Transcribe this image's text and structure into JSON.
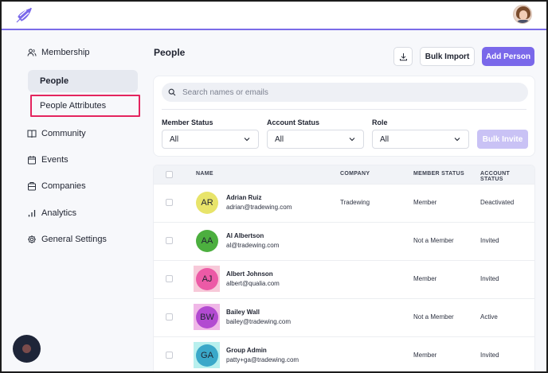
{
  "app": {
    "brand_color": "#7a68ea"
  },
  "topbar": {
    "logo_icon": "leaf-logo-icon",
    "user_avatar": "user-avatar"
  },
  "sidebar": {
    "section": {
      "label": "Membership",
      "icon": "users-icon"
    },
    "subitems": [
      {
        "label": "People",
        "active": true
      },
      {
        "label": "People Attributes",
        "highlighted": true
      }
    ],
    "items": [
      {
        "label": "Community",
        "icon": "book-icon"
      },
      {
        "label": "Events",
        "icon": "calendar-icon"
      },
      {
        "label": "Companies",
        "icon": "building-icon"
      },
      {
        "label": "Analytics",
        "icon": "bar-chart-icon"
      },
      {
        "label": "General Settings",
        "icon": "gear-icon"
      }
    ]
  },
  "main": {
    "title": "People",
    "actions": {
      "download_icon": "download-icon",
      "bulk_import": "Bulk Import",
      "add_person": "Add Person"
    },
    "search": {
      "placeholder": "Search names or emails",
      "value": ""
    },
    "filters": [
      {
        "label": "Member Status",
        "value": "All"
      },
      {
        "label": "Account Status",
        "value": "All"
      },
      {
        "label": "Role",
        "value": "All"
      }
    ],
    "bulk_invite": "Bulk Invite",
    "table": {
      "columns": [
        "NAME",
        "COMPANY",
        "MEMBER STATUS",
        "ACCOUNT STATUS"
      ],
      "rows": [
        {
          "initials": "AR",
          "name": "Adrian Ruiz",
          "email": "adrian@tradewing.com",
          "company": "Tradewing",
          "member_status": "Member",
          "account_status": "Deactivated",
          "avatar_color": "#e8e46a",
          "square_color": ""
        },
        {
          "initials": "AA",
          "name": "Al Albertson",
          "email": "al@tradewing.com",
          "company": "",
          "member_status": "Not a Member",
          "account_status": "Invited",
          "avatar_color": "#4caf3f",
          "square_color": ""
        },
        {
          "initials": "AJ",
          "name": "Albert Johnson",
          "email": "albert@qualia.com",
          "company": "",
          "member_status": "Member",
          "account_status": "Invited",
          "avatar_color": "#ec5aa6",
          "square_color": "#f7c9d9"
        },
        {
          "initials": "BW",
          "name": "Bailey Wall",
          "email": "bailey@tradewing.com",
          "company": "",
          "member_status": "Not a Member",
          "account_status": "Active",
          "avatar_color": "#b24ad1",
          "square_color": "#f0b7e7"
        },
        {
          "initials": "GA",
          "name": "Group Admin",
          "email": "patty+ga@tradewing.com",
          "company": "",
          "member_status": "Member",
          "account_status": "Invited",
          "avatar_color": "#3aa8c9",
          "square_color": "#b8f0ee"
        }
      ]
    }
  },
  "fab": {
    "icon": "chat-launcher-icon"
  }
}
